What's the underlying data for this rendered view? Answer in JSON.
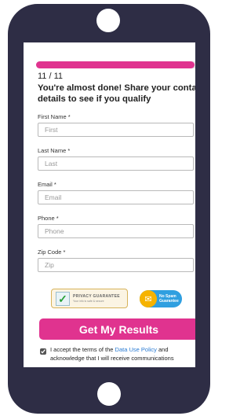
{
  "form": {
    "progress_fraction": 0.955,
    "step": "11 / 11",
    "headline": "You're almost done! Share your contact details to see if you qualify",
    "fields": [
      {
        "label": "First Name *",
        "placeholder": "First"
      },
      {
        "label": "Last Name *",
        "placeholder": "Last"
      },
      {
        "label": "Email *",
        "placeholder": "Email"
      },
      {
        "label": "Phone *",
        "placeholder": "Phone"
      },
      {
        "label": "Zip Code *",
        "placeholder": "Zip"
      }
    ],
    "badges": {
      "privacy_title": "PRIVACY GUARANTEE",
      "privacy_sub": "Your info is safe & secure",
      "spam_line1": "No Spam",
      "spam_line2": "Guarantee"
    },
    "submit_label": "Get My Results",
    "consent": {
      "checked": true,
      "text_before": "I accept the terms of the ",
      "link_text": "Data Use Policy",
      "text_after": " and acknowledge that I will receive communications"
    }
  },
  "colors": {
    "accent": "#e0338f",
    "phone_body": "#2e2d45",
    "link": "#2b7cd3"
  }
}
